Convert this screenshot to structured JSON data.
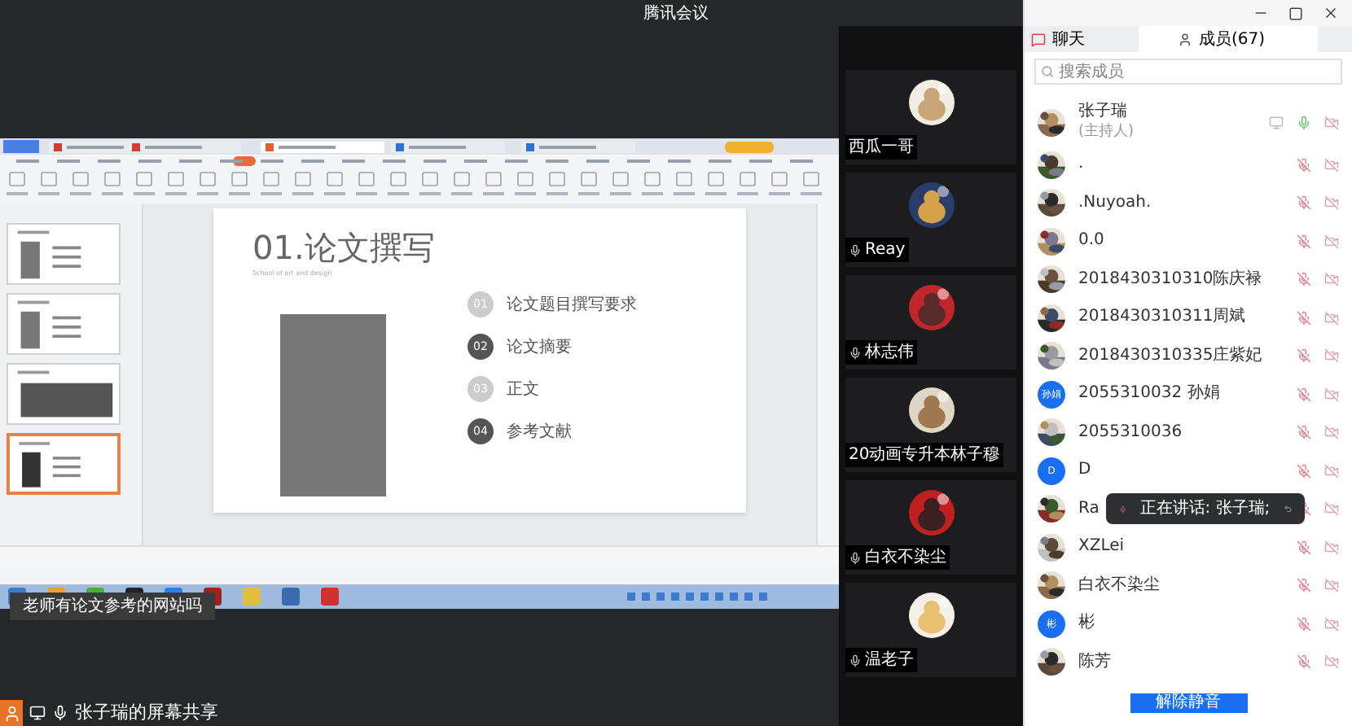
{
  "window": {
    "title": "腾讯会议"
  },
  "shared_screen": {
    "slide": {
      "title": "01.论文撰写",
      "subtitle": "School of art and design",
      "items": [
        {
          "number": "01",
          "label": "论文题目撰写要求",
          "kind": "light"
        },
        {
          "number": "02",
          "label": "论文摘要",
          "kind": "dark"
        },
        {
          "number": "03",
          "label": "正文",
          "kind": "light"
        },
        {
          "number": "04",
          "label": "参考文献",
          "kind": "dark"
        }
      ]
    },
    "thumbnails": [
      {
        "selected": false
      },
      {
        "selected": false
      },
      {
        "selected": false
      },
      {
        "selected": true
      }
    ],
    "caption": "老师有论文参考的网站吗",
    "label": "张子瑞的屏幕共享"
  },
  "videos": [
    {
      "name": "西瓜一哥",
      "mic_icon": false
    },
    {
      "name": "Reay",
      "mic_icon": true
    },
    {
      "name": "林志伟",
      "mic_icon": true
    },
    {
      "name": "20动画专升本林子穆",
      "mic_icon": false
    },
    {
      "name": "白衣不染尘",
      "mic_icon": true
    },
    {
      "name": "温老子",
      "mic_icon": true
    }
  ],
  "panel": {
    "tabs": [
      {
        "label": "聊天",
        "selected": false
      },
      {
        "label": "成员(67)",
        "selected": true
      }
    ],
    "search": {
      "placeholder": "搜索成员"
    },
    "members": [
      {
        "name": "张子瑞",
        "role": "(主持人)",
        "muted": false
      },
      {
        "name": ".",
        "muted": true
      },
      {
        "name": ".Nuyoah.",
        "muted": true
      },
      {
        "name": "0.0",
        "muted": true
      },
      {
        "name": "2018430310310陈庆禄",
        "muted": true
      },
      {
        "name": "2018430310311周斌",
        "muted": true
      },
      {
        "name": "2018430310335庄紫妃",
        "muted": true
      },
      {
        "name": "2055310032 孙娟",
        "kind": "letter",
        "initial": "孙娟",
        "muted": true
      },
      {
        "name": "2055310036",
        "muted": true
      },
      {
        "name": "D",
        "kind": "letter",
        "initial": "D",
        "muted": true
      },
      {
        "name": "Ra",
        "muted": true
      },
      {
        "name": "XZLei",
        "muted": true
      },
      {
        "name": "白衣不染尘",
        "muted": true
      },
      {
        "name": "彬",
        "kind": "letter",
        "initial": "彬",
        "muted": true
      },
      {
        "name": "陈芳",
        "muted": true
      }
    ],
    "speaking_toast": "正在讲话: 张子瑞;",
    "button": "解除静音"
  }
}
